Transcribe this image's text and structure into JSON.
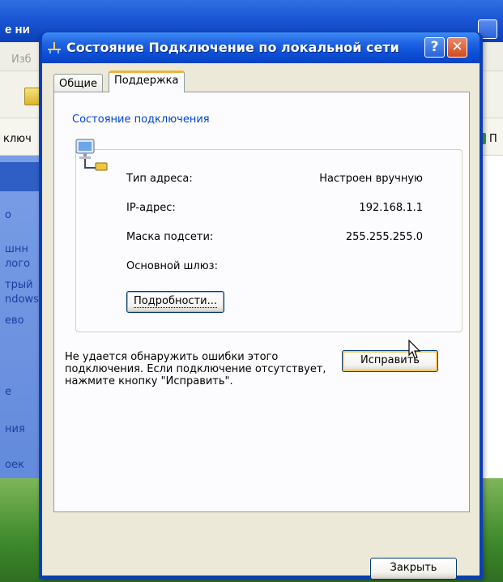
{
  "background_window": {
    "title": "е ни",
    "menu_favorites": "Изб",
    "address_text": "ключ",
    "go_text": "П",
    "left_panel_items": [
      "о",
      "шнн",
      "лого",
      "трый",
      "ndows",
      "ево",
      "е",
      "ния",
      "оек"
    ]
  },
  "dialog": {
    "title": "Состояние Подключение по локальной сети",
    "help_label": "?",
    "close_label": "✕",
    "tabs": [
      {
        "label": "Общие",
        "active": false
      },
      {
        "label": "Поддержка",
        "active": true
      }
    ],
    "groupbox": {
      "title": "Состояние подключения",
      "rows": [
        {
          "label": "Тип адреса:",
          "value": "Настроен вручную"
        },
        {
          "label": "IP-адрес:",
          "value": "192.168.1.1"
        },
        {
          "label": "Маска подсети:",
          "value": "255.255.255.0"
        },
        {
          "label": "Основной шлюз:",
          "value": ""
        }
      ],
      "details_button": "Подробности..."
    },
    "message": "Не удается обнаружить ошибки этого подключения. Если подключение отсутствует, нажмите кнопку \"Исправить\".",
    "repair_button": "Исправить",
    "close_button": "Закрыть"
  },
  "colors": {
    "titlebar": "#0b4fd6",
    "groupbox_title": "#0046d5",
    "window_face": "#ece9d8",
    "close_button": "#cf4a1e",
    "focus_highlight": "#f8c864"
  },
  "icons": [
    "network-connection-icon",
    "mouse-pointer-icon",
    "folder-icon",
    "go-arrow-icon"
  ]
}
